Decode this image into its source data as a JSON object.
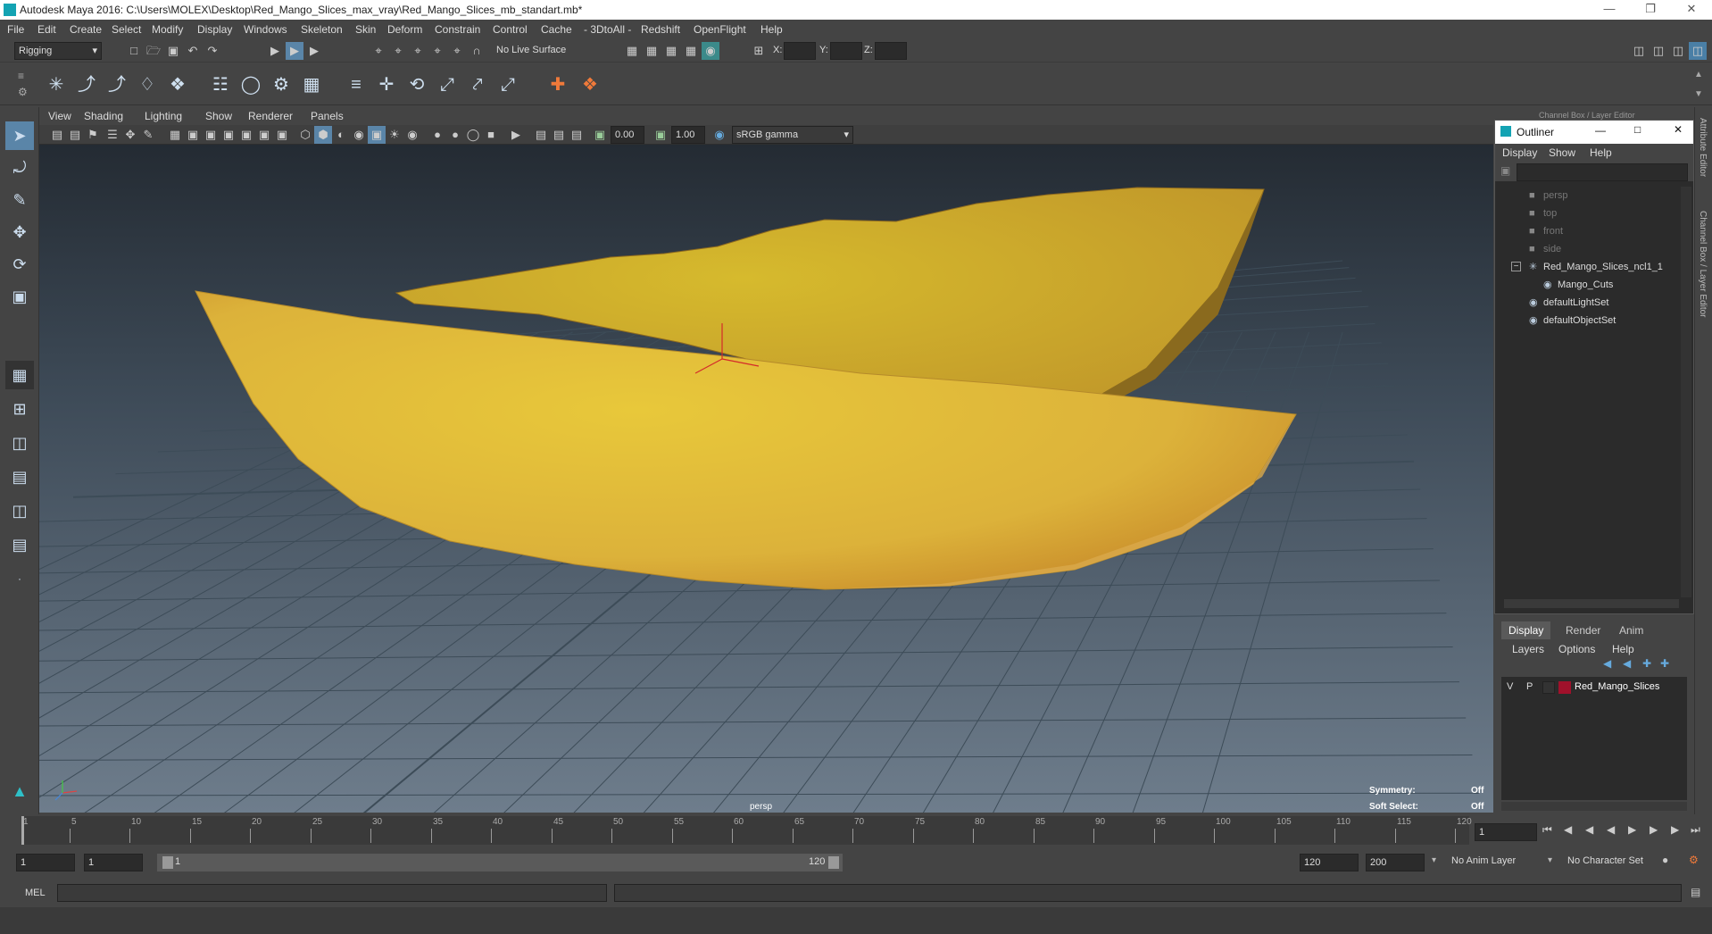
{
  "app": {
    "title": "Autodesk Maya 2016: C:\\Users\\MOLEX\\Desktop\\Red_Mango_Slices_max_vray\\Red_Mango_Slices_mb_standart.mb*"
  },
  "menu": [
    "File",
    "Edit",
    "Create",
    "Select",
    "Modify",
    "Display",
    "Windows",
    "Skeleton",
    "Skin",
    "Deform",
    "Constrain",
    "Control",
    "Cache",
    "- 3DtoAll -",
    "Redshift",
    "OpenFlight",
    "Help"
  ],
  "status": {
    "mode": "Rigging",
    "live_surface": "No Live Surface",
    "x_label": "X:",
    "y_label": "Y:",
    "z_label": "Z:"
  },
  "panel": {
    "menu": [
      "View",
      "Shading",
      "Lighting",
      "Show",
      "Renderer",
      "Panels"
    ],
    "exposure": "0.00",
    "gamma": "1.00",
    "colorspace": "sRGB gamma",
    "camera_label": "persp",
    "symmetry_label": "Symmetry:",
    "symmetry_value": "Off",
    "softselect_label": "Soft Select:",
    "softselect_value": "Off"
  },
  "outliner": {
    "title": "Outliner",
    "menu": [
      "Display",
      "Show",
      "Help"
    ],
    "items": [
      {
        "label": "persp",
        "dim": true,
        "indent": 0
      },
      {
        "label": "top",
        "dim": true,
        "indent": 0
      },
      {
        "label": "front",
        "dim": true,
        "indent": 0
      },
      {
        "label": "side",
        "dim": true,
        "indent": 0
      },
      {
        "label": "Red_Mango_Slices_ncl1_1",
        "dim": false,
        "indent": 0
      },
      {
        "label": "Mango_Cuts",
        "dim": false,
        "indent": 1
      },
      {
        "label": "defaultLightSet",
        "dim": false,
        "indent": 0
      },
      {
        "label": "defaultObjectSet",
        "dim": false,
        "indent": 0
      }
    ]
  },
  "layers": {
    "tabs": [
      "Display",
      "Render",
      "Anim"
    ],
    "menu": [
      "Layers",
      "Options",
      "Help"
    ],
    "row": {
      "v": "V",
      "p": "P",
      "name": "Red_Mango_Slices",
      "color": "#a0112b"
    }
  },
  "side_tabs": [
    "Attribute Editor",
    "Channel Box / Layer Editor"
  ],
  "overlay_title": "Channel Box / Layer Editor",
  "timeline": {
    "ticks": [
      "1",
      "5",
      "10",
      "15",
      "20",
      "25",
      "30",
      "35",
      "40",
      "45",
      "50",
      "55",
      "60",
      "65",
      "70",
      "75",
      "80",
      "85",
      "90",
      "95",
      "100",
      "105",
      "110",
      "115",
      "120"
    ],
    "current": "1"
  },
  "range": {
    "start": "1",
    "start2": "1",
    "slider_start": "1",
    "slider_end": "120",
    "end": "120",
    "end2": "200",
    "anim_layer": "No Anim Layer",
    "char_set": "No Character Set"
  },
  "mel": {
    "label": "MEL"
  }
}
